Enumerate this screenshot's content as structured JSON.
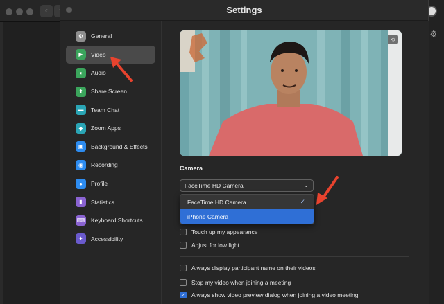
{
  "window": {
    "title": "Settings"
  },
  "sidebar": {
    "items": [
      {
        "label": "General",
        "icon": "gear-icon",
        "color": "#8e8e8e",
        "glyph": "⚙"
      },
      {
        "label": "Video",
        "icon": "video-icon",
        "color": "#3ba55c",
        "glyph": "▶"
      },
      {
        "label": "Audio",
        "icon": "headphones-icon",
        "color": "#3ba55c",
        "glyph": "◖"
      },
      {
        "label": "Share Screen",
        "icon": "share-screen-icon",
        "color": "#3ba55c",
        "glyph": "⬆"
      },
      {
        "label": "Team Chat",
        "icon": "chat-icon",
        "color": "#2aa5b5",
        "glyph": "▬"
      },
      {
        "label": "Zoom Apps",
        "icon": "apps-icon",
        "color": "#2aa5b5",
        "glyph": "◆"
      },
      {
        "label": "Background & Effects",
        "icon": "background-icon",
        "color": "#2d8cf0",
        "glyph": "▣"
      },
      {
        "label": "Recording",
        "icon": "recording-icon",
        "color": "#2d8cf0",
        "glyph": "◉"
      },
      {
        "label": "Profile",
        "icon": "profile-icon",
        "color": "#2d8cf0",
        "glyph": "●"
      },
      {
        "label": "Statistics",
        "icon": "statistics-icon",
        "color": "#8a63d2",
        "glyph": "▮"
      },
      {
        "label": "Keyboard Shortcuts",
        "icon": "keyboard-icon",
        "color": "#8a63d2",
        "glyph": "⌨"
      },
      {
        "label": "Accessibility",
        "icon": "accessibility-icon",
        "color": "#6a5acd",
        "glyph": "✦"
      }
    ],
    "active_index": 1
  },
  "video": {
    "camera_label": "Camera",
    "camera_selected": "FaceTime HD Camera",
    "camera_options": [
      "FaceTime HD Camera",
      "iPhone Camera"
    ],
    "checked_option": "FaceTime HD Camera",
    "highlighted_option": "iPhone Camera"
  },
  "options": [
    {
      "label": "Touch up my appearance",
      "checked": false
    },
    {
      "label": "Adjust for low light",
      "checked": false
    },
    {
      "label": "Always display participant name on their videos",
      "checked": false
    },
    {
      "label": "Stop my video when joining a meeting",
      "checked": false
    },
    {
      "label": "Always show video preview dialog when joining a video meeting",
      "checked": true
    }
  ],
  "colors": {
    "accent": "#2f6fd6",
    "arrow": "#e8432e"
  }
}
